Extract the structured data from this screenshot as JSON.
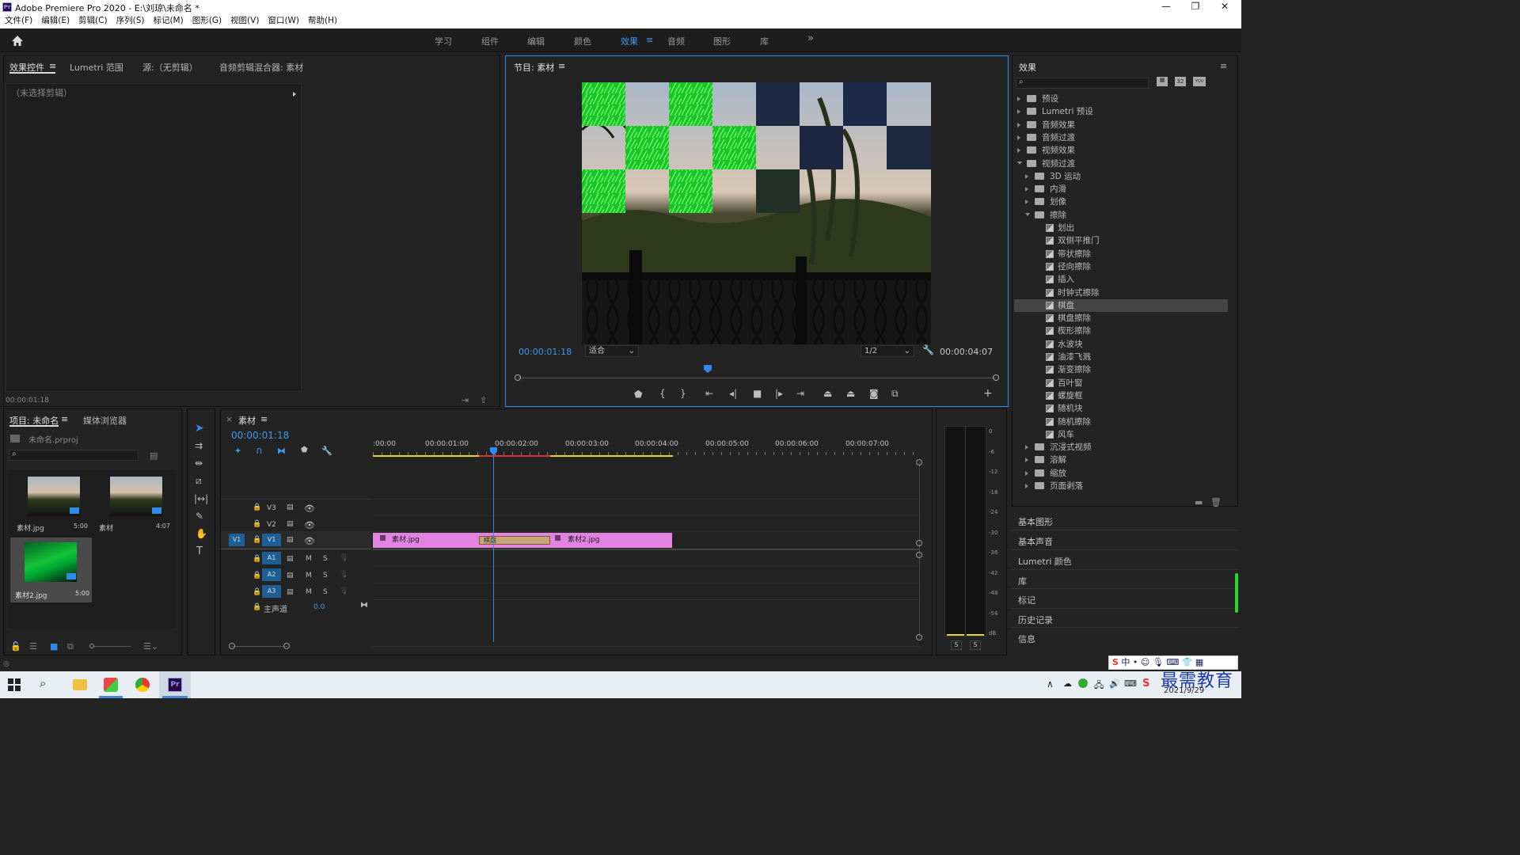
{
  "window": {
    "title": "Adobe Premiere Pro 2020 - E:\\刘琼\\未命名 *",
    "app_icon": "Pr",
    "min": "—",
    "max": "❐",
    "close": "✕"
  },
  "menu": [
    "文件(F)",
    "编辑(E)",
    "剪辑(C)",
    "序列(S)",
    "标记(M)",
    "图形(G)",
    "视图(V)",
    "窗口(W)",
    "帮助(H)"
  ],
  "workspaces": [
    "学习",
    "组件",
    "编辑",
    "颜色",
    "效果",
    "音频",
    "图形",
    "库"
  ],
  "active_workspace": "效果",
  "workspace_more": "»",
  "source_panel": {
    "tabs": [
      "效果控件",
      "Lumetri 范围",
      "源:（无剪辑）",
      "音频剪辑混合器: 素材"
    ],
    "no_clip": "（未选择剪辑）",
    "timecode": "00:00:01:18"
  },
  "program": {
    "title": "节目: 素材",
    "timecode_left": "00:00:01:18",
    "fit": "适合",
    "resolution": "1/2",
    "timecode_right": "00:00:04:07"
  },
  "effects_panel": {
    "title": "效果",
    "tree": [
      {
        "label": "预设",
        "level": 0,
        "kind": "folder",
        "open": false
      },
      {
        "label": "Lumetri 预设",
        "level": 0,
        "kind": "folder",
        "open": false
      },
      {
        "label": "音频效果",
        "level": 0,
        "kind": "folder",
        "open": false
      },
      {
        "label": "音频过渡",
        "level": 0,
        "kind": "folder",
        "open": false
      },
      {
        "label": "视频效果",
        "level": 0,
        "kind": "folder",
        "open": false
      },
      {
        "label": "视频过渡",
        "level": 0,
        "kind": "folder",
        "open": true
      },
      {
        "label": "3D 运动",
        "level": 1,
        "kind": "folder",
        "open": false
      },
      {
        "label": "内滑",
        "level": 1,
        "kind": "folder",
        "open": false
      },
      {
        "label": "划像",
        "level": 1,
        "kind": "folder",
        "open": false
      },
      {
        "label": "擦除",
        "level": 1,
        "kind": "folder",
        "open": true
      },
      {
        "label": "划出",
        "level": 2,
        "kind": "fx"
      },
      {
        "label": "双侧平推门",
        "level": 2,
        "kind": "fx"
      },
      {
        "label": "带状擦除",
        "level": 2,
        "kind": "fx"
      },
      {
        "label": "径向擦除",
        "level": 2,
        "kind": "fx"
      },
      {
        "label": "插入",
        "level": 2,
        "kind": "fx"
      },
      {
        "label": "时钟式擦除",
        "level": 2,
        "kind": "fx"
      },
      {
        "label": "棋盘",
        "level": 2,
        "kind": "fx",
        "selected": true
      },
      {
        "label": "棋盘擦除",
        "level": 2,
        "kind": "fx"
      },
      {
        "label": "楔形擦除",
        "level": 2,
        "kind": "fx"
      },
      {
        "label": "水波块",
        "level": 2,
        "kind": "fx"
      },
      {
        "label": "油漆飞溅",
        "level": 2,
        "kind": "fx"
      },
      {
        "label": "渐变擦除",
        "level": 2,
        "kind": "fx"
      },
      {
        "label": "百叶窗",
        "level": 2,
        "kind": "fx"
      },
      {
        "label": "螺旋框",
        "level": 2,
        "kind": "fx"
      },
      {
        "label": "随机块",
        "level": 2,
        "kind": "fx"
      },
      {
        "label": "随机擦除",
        "level": 2,
        "kind": "fx"
      },
      {
        "label": "风车",
        "level": 2,
        "kind": "fx"
      },
      {
        "label": "沉浸式视频",
        "level": 1,
        "kind": "folder",
        "open": false
      },
      {
        "label": "溶解",
        "level": 1,
        "kind": "folder",
        "open": false
      },
      {
        "label": "缩放",
        "level": 1,
        "kind": "folder",
        "open": false
      },
      {
        "label": "页面剥落",
        "level": 1,
        "kind": "folder",
        "open": false
      }
    ],
    "icon_btns": [
      "32",
      "YUV"
    ]
  },
  "side_sections": [
    "基本图形",
    "基本声音",
    "Lumetri 颜色",
    "库",
    "标记",
    "历史记录",
    "信息"
  ],
  "project": {
    "tabs": [
      "项目: 未命名",
      "媒体浏览器"
    ],
    "file": "未命名.prproj",
    "items": [
      {
        "name": "素材.jpg",
        "dur": "5:00"
      },
      {
        "name": "素材",
        "dur": "4:07"
      },
      {
        "name": "素材2.jpg",
        "dur": "5:00"
      }
    ]
  },
  "timeline": {
    "tab": "素材",
    "timecode": "00:00:01:18",
    "ruler": [
      ":00:00",
      "00:00:01:00",
      "00:00:02:00",
      "00:00:03:00",
      "00:00:04:00",
      "00:00:05:00",
      "00:00:06:00",
      "00:00:07:00"
    ],
    "video_tracks": [
      "V3",
      "V2",
      "V1"
    ],
    "audio_tracks": [
      "A1",
      "A2",
      "A3"
    ],
    "master": "主声道",
    "master_val": "0.0",
    "src_v": "V1",
    "clip1": "素材.jpg",
    "clip2": "素材2.jpg",
    "transition": "棋盘",
    "m": "M",
    "s": "S"
  },
  "meter": {
    "scale": [
      "0",
      "-6",
      "-12",
      "-18",
      "-24",
      "-30",
      "-36",
      "-42",
      "-48",
      "-54",
      "dB"
    ],
    "solo": "S"
  },
  "taskbar": {
    "date": "2021/9/29",
    "watermark": "最需教育"
  },
  "colors": {
    "accent": "#2d8ceb",
    "clip": "#e283e1",
    "transition": "#c9a476",
    "green": "#2bd62b"
  }
}
